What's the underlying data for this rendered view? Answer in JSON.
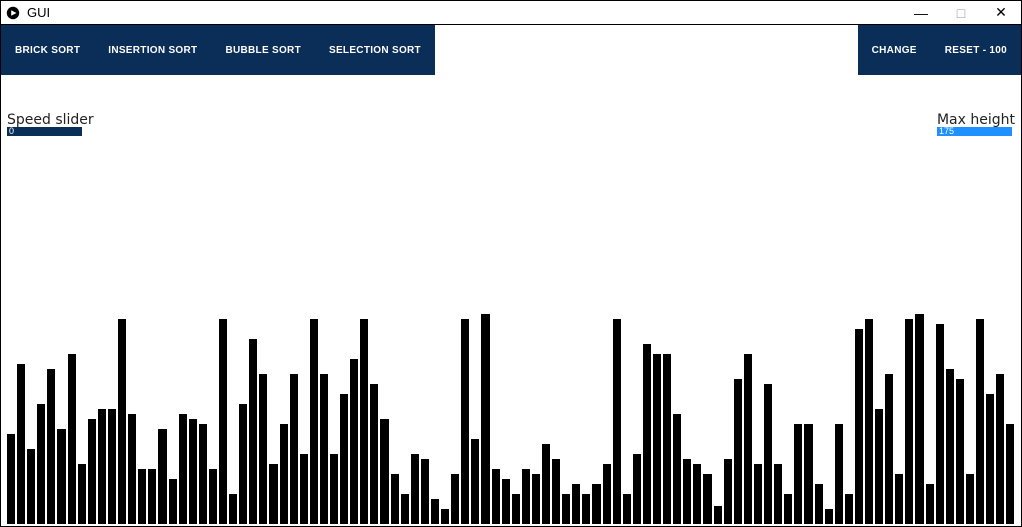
{
  "window": {
    "title": "GUI",
    "controls": {
      "minimize": "—",
      "maximize": "□",
      "close": "✕"
    }
  },
  "toolbar": {
    "left": [
      {
        "label": "BRICK SORT"
      },
      {
        "label": "INSERTION SORT"
      },
      {
        "label": "BUBBLE SORT"
      },
      {
        "label": "SELECTION SORT"
      }
    ],
    "right": [
      {
        "label": "CHANGE"
      },
      {
        "label": "RESET - 100"
      }
    ]
  },
  "sliders": {
    "speed": {
      "label": "Speed slider",
      "value": "0",
      "fill_color": "#0b2e59",
      "fill_percent": 100
    },
    "max_height": {
      "label": "Max height",
      "value": "175",
      "fill_color": "#1e90ff",
      "fill_percent": 100
    }
  },
  "chart_data": {
    "type": "bar",
    "title": "",
    "xlabel": "",
    "ylabel": "",
    "ylim": [
      0,
      210
    ],
    "categories": [],
    "values": [
      90,
      160,
      75,
      120,
      155,
      95,
      170,
      60,
      105,
      115,
      115,
      205,
      110,
      55,
      55,
      95,
      45,
      110,
      105,
      100,
      55,
      205,
      30,
      120,
      185,
      150,
      60,
      100,
      150,
      70,
      205,
      150,
      70,
      130,
      165,
      205,
      140,
      105,
      50,
      30,
      70,
      65,
      25,
      15,
      50,
      205,
      85,
      210,
      55,
      45,
      30,
      55,
      50,
      80,
      65,
      30,
      40,
      30,
      40,
      60,
      205,
      30,
      70,
      180,
      170,
      170,
      110,
      65,
      60,
      50,
      18,
      65,
      145,
      170,
      60,
      140,
      60,
      30,
      100,
      100,
      40,
      15,
      100,
      30,
      195,
      205,
      115,
      150,
      50,
      205,
      210,
      40,
      200,
      155,
      145,
      50,
      205,
      130,
      150,
      100
    ]
  },
  "colors": {
    "toolbar_bg": "#0b2e59",
    "bar_color": "#000000",
    "speed_slider_fill": "#0b2e59",
    "max_height_slider_fill": "#1e90ff"
  }
}
